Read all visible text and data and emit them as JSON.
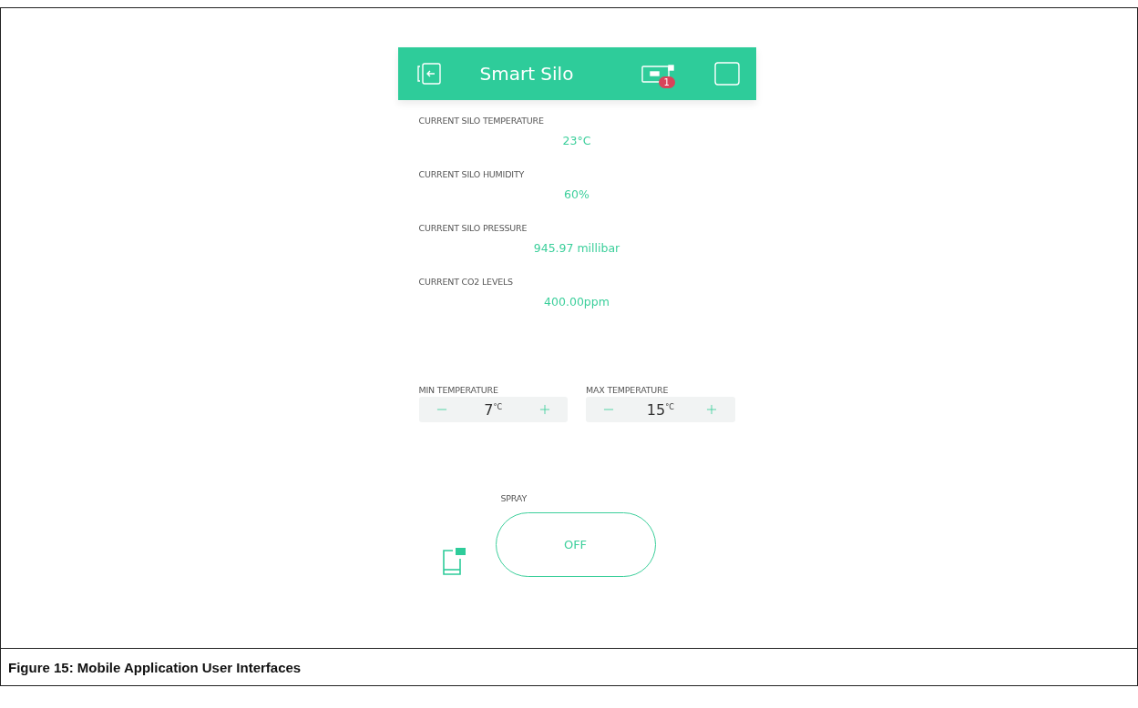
{
  "app_bar": {
    "title": "Smart Silo",
    "device_badge": "1"
  },
  "readings": [
    {
      "label": "CURRENT SILO TEMPERATURE",
      "value": "23°C"
    },
    {
      "label": "CURRENT SILO HUMIDITY",
      "value": "60%"
    },
    {
      "label": "CURRENT SILO PRESSURE",
      "value": "945.97 millibar"
    },
    {
      "label": "CURRENT CO2 LEVELS",
      "value": "400.00ppm"
    }
  ],
  "steppers": [
    {
      "label": "MIN TEMPERATURE",
      "value": "7$^{°C}$"
    },
    {
      "label": "MAX TEMPERATURE",
      "value": "15$^{°C}$"
    }
  ],
  "spray": {
    "label": "SPRAY",
    "button": "OFF",
    "on": false
  },
  "caption": "Figure 15: Mobile Application User Interfaces"
}
